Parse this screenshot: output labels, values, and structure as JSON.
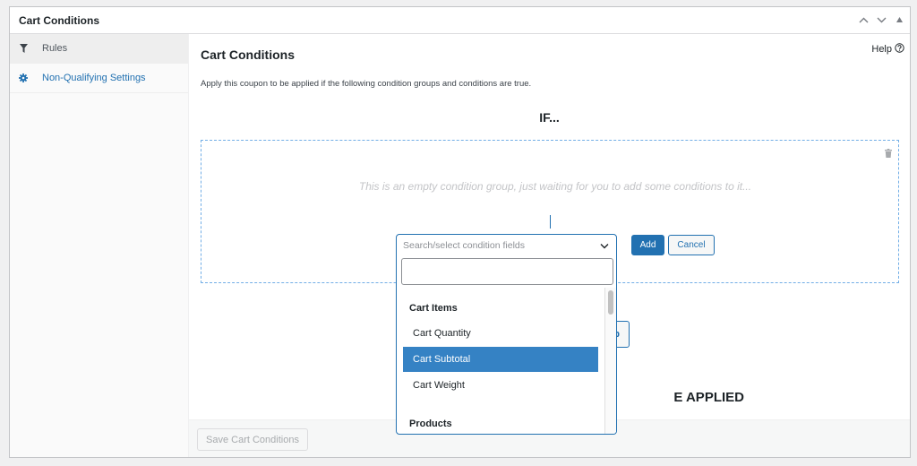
{
  "panel": {
    "title": "Cart Conditions",
    "controls": [
      {
        "name": "move-up",
        "icon": "chevron-up-icon"
      },
      {
        "name": "move-down",
        "icon": "chevron-down-icon"
      },
      {
        "name": "toggle-panel",
        "icon": "triangle-up-icon"
      }
    ]
  },
  "sidebar": {
    "items": [
      {
        "label": "Rules",
        "icon": "filter-icon",
        "active": true
      },
      {
        "label": "Non-Qualifying Settings",
        "icon": "gear-icon",
        "active": false
      }
    ]
  },
  "main": {
    "title": "Cart Conditions",
    "help_label": "Help",
    "description": "Apply this coupon to be applied if the following condition groups and conditions are true.",
    "if_label": "IF...",
    "condition_group": {
      "empty_message": "This is an empty condition group, just waiting for you to add some conditions to it..."
    },
    "add_button": "Add",
    "cancel_button": "Cancel",
    "hidden_button_fragment": "p",
    "then_label_fragment": "E APPLIED",
    "save_button": "Save Cart Conditions"
  },
  "dropdown": {
    "placeholder": "Search/select condition fields",
    "search_value": "",
    "groups": [
      {
        "label": "Cart Items",
        "options": [
          {
            "label": "Cart Quantity",
            "selected": false
          },
          {
            "label": "Cart Subtotal",
            "selected": true
          },
          {
            "label": "Cart Weight",
            "selected": false
          }
        ]
      },
      {
        "label": "Products",
        "options": []
      }
    ]
  },
  "colors": {
    "accent": "#2271b1",
    "highlight": "#3582c4",
    "dashed_border": "#72aee6",
    "muted_text": "#c3c4c7"
  }
}
